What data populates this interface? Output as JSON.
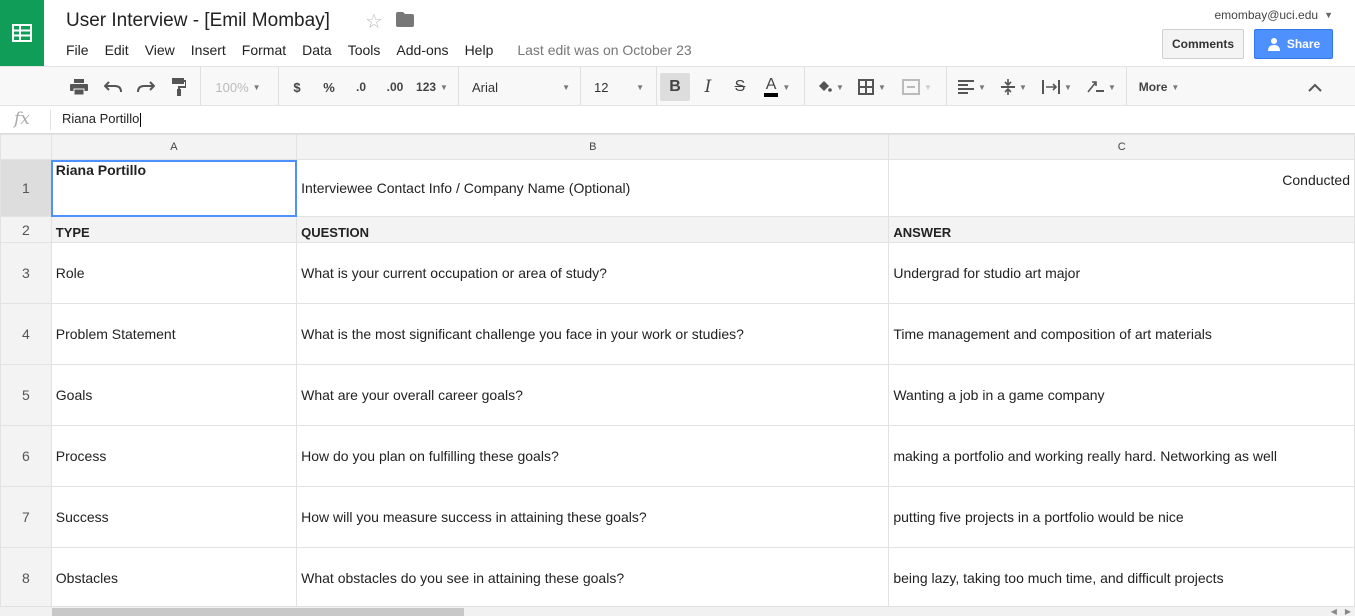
{
  "app": {
    "title": "User Interview - [Emil Mombay]",
    "account": "emombay@uci.edu",
    "last_edit": "Last edit was on October 23"
  },
  "menu": [
    "File",
    "Edit",
    "View",
    "Insert",
    "Format",
    "Data",
    "Tools",
    "Add-ons",
    "Help"
  ],
  "buttons": {
    "comments": "Comments",
    "share": "Share"
  },
  "toolbar": {
    "zoom": "100%",
    "currency": "$",
    "percent": "%",
    "decrease_decimal": ".0",
    "increase_decimal": ".00",
    "number_format": "123",
    "font": "Arial",
    "font_size": "12",
    "bold": "B",
    "italic": "I",
    "strike": "S",
    "text_color": "A",
    "more": "More"
  },
  "formula_bar": {
    "fx": "fx",
    "value": "Riana Portillo"
  },
  "columns": [
    "A",
    "B",
    "C"
  ],
  "rows": [
    {
      "num": "1",
      "a": "Riana Portillo",
      "b": "Interviewee Contact Info / Company Name (Optional)",
      "c": "Conducted"
    },
    {
      "num": "2",
      "a": "TYPE",
      "b": "QUESTION",
      "c": "ANSWER"
    },
    {
      "num": "3",
      "a": "Role",
      "b": "What is your current occupation or area of study?",
      "c": "Undergrad for studio art major"
    },
    {
      "num": "4",
      "a": "Problem Statement",
      "b": "What is the most significant challenge you face in your work or studies?",
      "c": "Time management and composition of art materials"
    },
    {
      "num": "5",
      "a": "Goals",
      "b": "What are your overall career goals?",
      "c": "Wanting a job in a game company"
    },
    {
      "num": "6",
      "a": "Process",
      "b": "How do you plan on fulfilling these goals?",
      "c": "making a portfolio and working really hard. Networking as well"
    },
    {
      "num": "7",
      "a": "Success",
      "b": "How will you measure success in attaining these goals?",
      "c": "putting five projects in a portfolio would be nice"
    },
    {
      "num": "8",
      "a": "Obstacles",
      "b": "What obstacles do you see in attaining these goals?",
      "c": "being lazy, taking too much time, and difficult projects"
    }
  ],
  "colors": {
    "brand": "#0f9d58",
    "share": "#4d90fe",
    "selection": "#4d90fe"
  }
}
